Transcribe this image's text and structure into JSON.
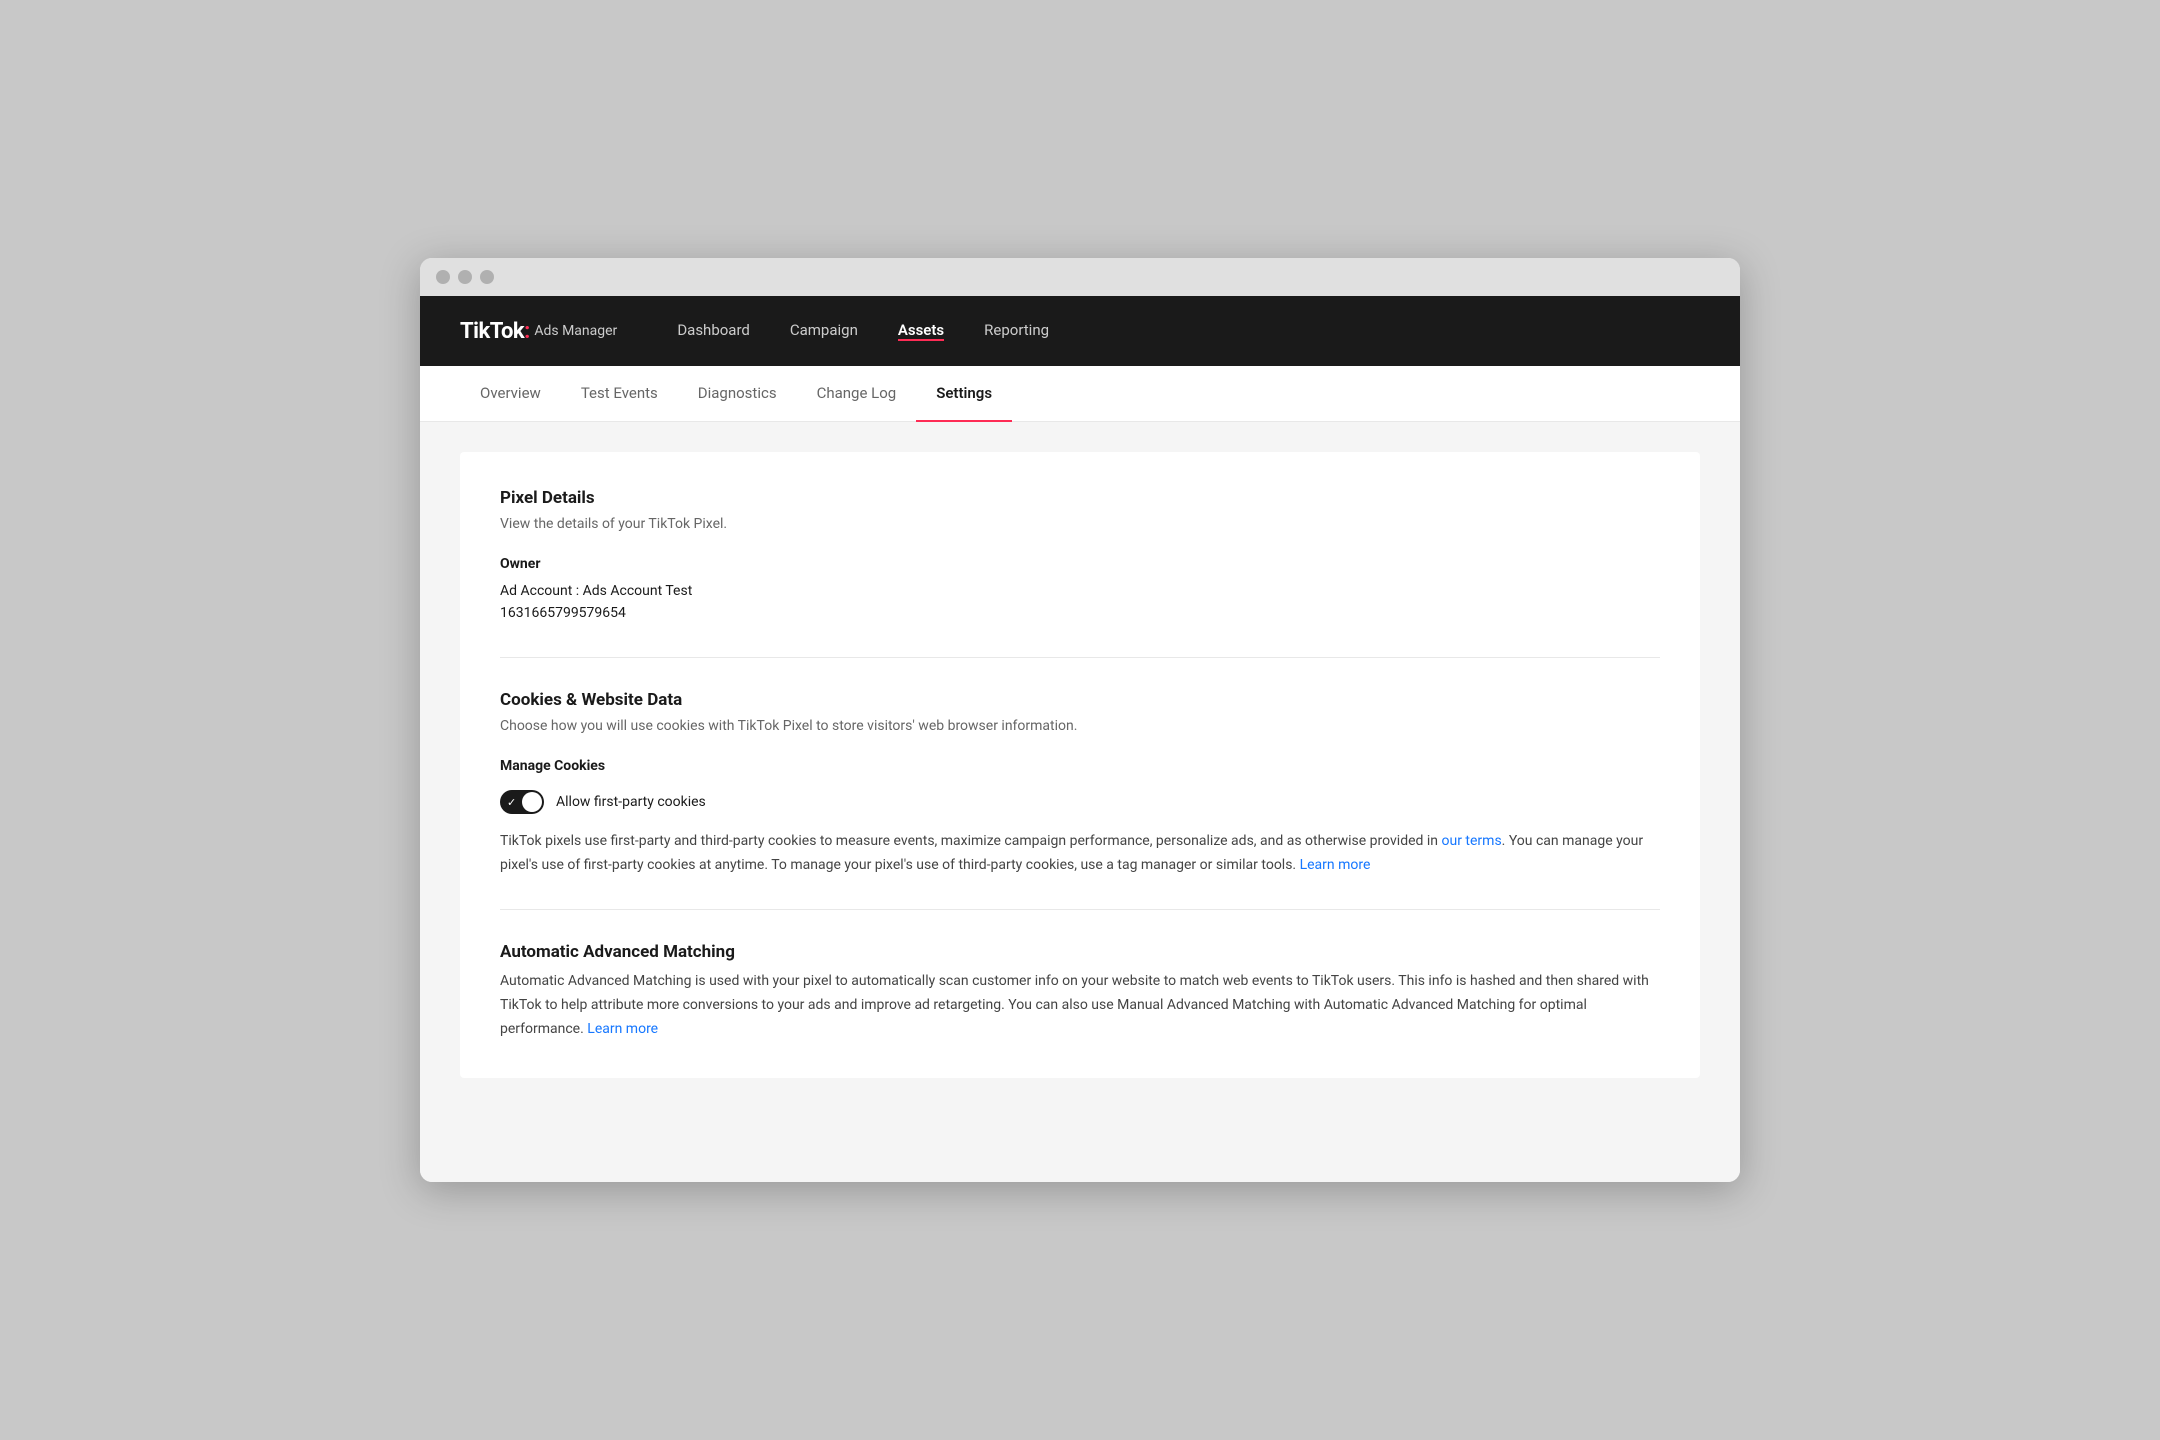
{
  "browser": {
    "traffic_lights": [
      "close",
      "minimize",
      "maximize"
    ]
  },
  "top_nav": {
    "logo": {
      "brand": "TikTok",
      "dot": ":",
      "subtitle": "Ads Manager"
    },
    "items": [
      {
        "label": "Dashboard",
        "active": false
      },
      {
        "label": "Campaign",
        "active": false
      },
      {
        "label": "Assets",
        "active": true
      },
      {
        "label": "Reporting",
        "active": false
      }
    ]
  },
  "sub_nav": {
    "items": [
      {
        "label": "Overview",
        "active": false
      },
      {
        "label": "Test Events",
        "active": false
      },
      {
        "label": "Diagnostics",
        "active": false
      },
      {
        "label": "Change Log",
        "active": false
      },
      {
        "label": "Settings",
        "active": true
      }
    ]
  },
  "pixel_details": {
    "title": "Pixel Details",
    "description": "View the details of your TikTok Pixel.",
    "owner_label": "Owner",
    "owner_value_line1": "Ad Account : Ads Account Test",
    "owner_value_line2": "1631665799579654"
  },
  "cookies_section": {
    "title": "Cookies & Website Data",
    "description": "Choose how you will use cookies with TikTok Pixel to store visitors' web browser information.",
    "manage_label": "Manage Cookies",
    "toggle_label": "Allow first-party cookies",
    "toggle_enabled": true,
    "description_text_1": "TikTok pixels use first-party and third-party cookies to measure events, maximize campaign performance, personalize ads, and as otherwise provided in ",
    "our_terms_link": "our terms",
    "description_text_2": ". You can manage your pixel's use of first-party cookies at anytime. To manage your pixel's use of third-party cookies, use a tag manager or similar tools. ",
    "learn_more_link_1": "Learn more"
  },
  "aam_section": {
    "title": "Automatic Advanced Matching",
    "description_text": "Automatic Advanced Matching is used with your pixel to automatically scan customer info on your website to match web events to TikTok users. This info is hashed and then shared with TikTok to help attribute more conversions to your ads and improve ad retargeting. You can also use Manual Advanced Matching with Automatic Advanced Matching for optimal performance. ",
    "learn_more_link": "Learn more"
  }
}
